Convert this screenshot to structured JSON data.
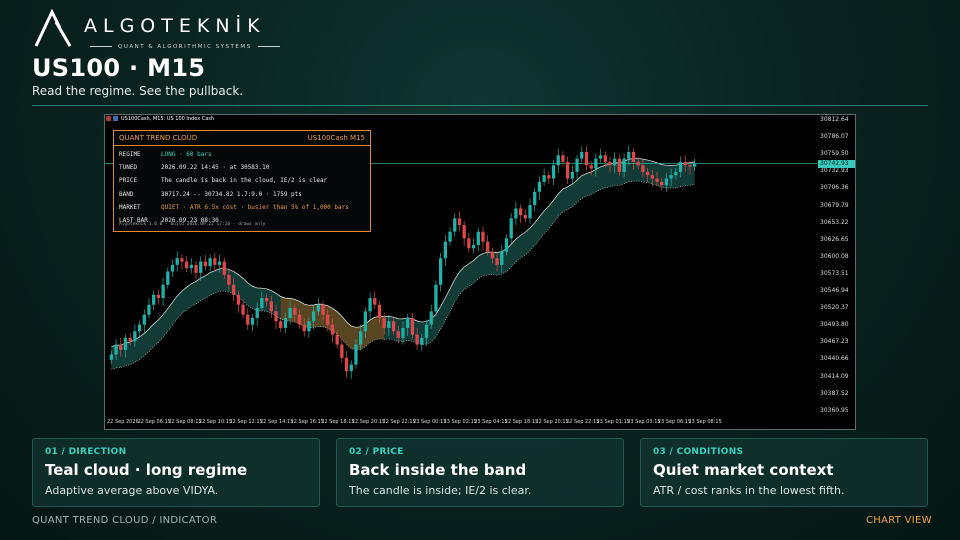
{
  "brand": {
    "name": "ALGOTEKNİK",
    "tagline": "QUANT & ALGORITHMIC SYSTEMS"
  },
  "header": {
    "title": "US100 · M15",
    "subtitle": "Read the regime. See the pullback."
  },
  "chart_window": {
    "title": "US100Cash, M15:  US 100 Index Cash"
  },
  "panel": {
    "name": "QUANT TREND CLOUD",
    "symbol": "US100Cash M15",
    "rows": [
      {
        "key": "REGIME",
        "value": "LONG · 60 bars",
        "color": "#3ed1c0"
      },
      {
        "key": "TUNED",
        "value": "2026.09.22 14:45 · at 30583.10",
        "color": "#e6e6e6"
      },
      {
        "key": "PRICE",
        "value": "The candle is back in the cloud, IE/2 is clear",
        "color": "#e6e6e6"
      },
      {
        "key": "BAND",
        "value": "30717.24 -- 30734.82  1.7:9.0 · 1759 pts",
        "color": "#e6e6e6"
      },
      {
        "key": "MARKET",
        "value": "QUIET · ATR 6.5x cost · busier than 5% of 1,000 bars",
        "color": "#f09a3a"
      },
      {
        "key": "LAST BAR",
        "value": "2026.09.23 08:30",
        "color": "#e6e6e6"
      }
    ],
    "footer": "Algoteknik 1.0.0 · build 2026.09.22 17:16 · draws only"
  },
  "chart_data": {
    "type": "candlestick",
    "y_ticks": [
      "30812.64",
      "30786.07",
      "30759.50",
      "30732.93",
      "30706.36",
      "30679.79",
      "30653.22",
      "30626.65",
      "30600.08",
      "30573.51",
      "30546.94",
      "30520.37",
      "30493.80",
      "30467.23",
      "30440.66",
      "30414.09",
      "30387.52",
      "30360.95"
    ],
    "current_price": "30742.93",
    "x_ticks": [
      "22 Sep 2026",
      "22 Sep 06:15",
      "22 Sep 08:15",
      "22 Sep 10:15",
      "22 Sep 12:15",
      "22 Sep 14:15",
      "22 Sep 16:15",
      "22 Sep 18:15",
      "22 Sep 20:15",
      "22 Sep 22:15",
      "23 Sep 00:15",
      "23 Sep 02:15",
      "23 Sep 04:15",
      "22 Sep 18:15",
      "22 Sep 20:15",
      "22 Sep 22:15",
      "23 Sep 01:15",
      "23 Sep 03:15",
      "23 Sep 06:15",
      "23 Sep 08:15"
    ],
    "colors": {
      "up": "#1fb3a8",
      "down": "#e0474c",
      "cloud_long": "#1d5a52",
      "cloud_pullback": "#6a4a1e",
      "line": "#e8f0ee"
    },
    "closes": [
      30455,
      30470,
      30462,
      30480,
      30475,
      30490,
      30500,
      30515,
      30530,
      30545,
      30540,
      30560,
      30580,
      30590,
      30600,
      30595,
      30585,
      30590,
      30578,
      30595,
      30588,
      30600,
      30590,
      30595,
      30575,
      30560,
      30545,
      30530,
      30515,
      30500,
      30510,
      30525,
      30540,
      30535,
      30520,
      30505,
      30495,
      30510,
      30525,
      30515,
      30500,
      30490,
      30505,
      30520,
      30530,
      30515,
      30500,
      30485,
      30470,
      30450,
      30430,
      30440,
      30470,
      30490,
      30520,
      30540,
      30530,
      30510,
      30495,
      30505,
      30490,
      30480,
      30495,
      30510,
      30485,
      30470,
      30480,
      30500,
      30520,
      30560,
      30600,
      30625,
      30640,
      30660,
      30650,
      30630,
      30615,
      30620,
      30640,
      30625,
      30610,
      30600,
      30590,
      30610,
      30630,
      30660,
      30675,
      30665,
      30660,
      30680,
      30700,
      30715,
      30725,
      30720,
      30740,
      30755,
      30745,
      30720,
      30730,
      30750,
      30760,
      30740,
      30735,
      30750,
      30755,
      30745,
      30740,
      30750,
      30730,
      30750,
      30760,
      30745,
      30740,
      30730,
      30725,
      30720,
      30715,
      30710,
      30720,
      30725,
      30730,
      30745,
      30740,
      30738,
      30742
    ]
  },
  "cards": [
    {
      "num": "01 / DIRECTION",
      "title": "Teal cloud · long regime",
      "desc": "Adaptive average above VIDYA."
    },
    {
      "num": "02 / PRICE",
      "title": "Back inside the band",
      "desc": "The candle is inside; IE/2 is clear."
    },
    {
      "num": "03 / CONDITIONS",
      "title": "Quiet market context",
      "desc": "ATR / cost ranks in the lowest fifth."
    }
  ],
  "footer": {
    "left": "QUANT TREND CLOUD / INDICATOR",
    "right": "CHART VIEW"
  }
}
